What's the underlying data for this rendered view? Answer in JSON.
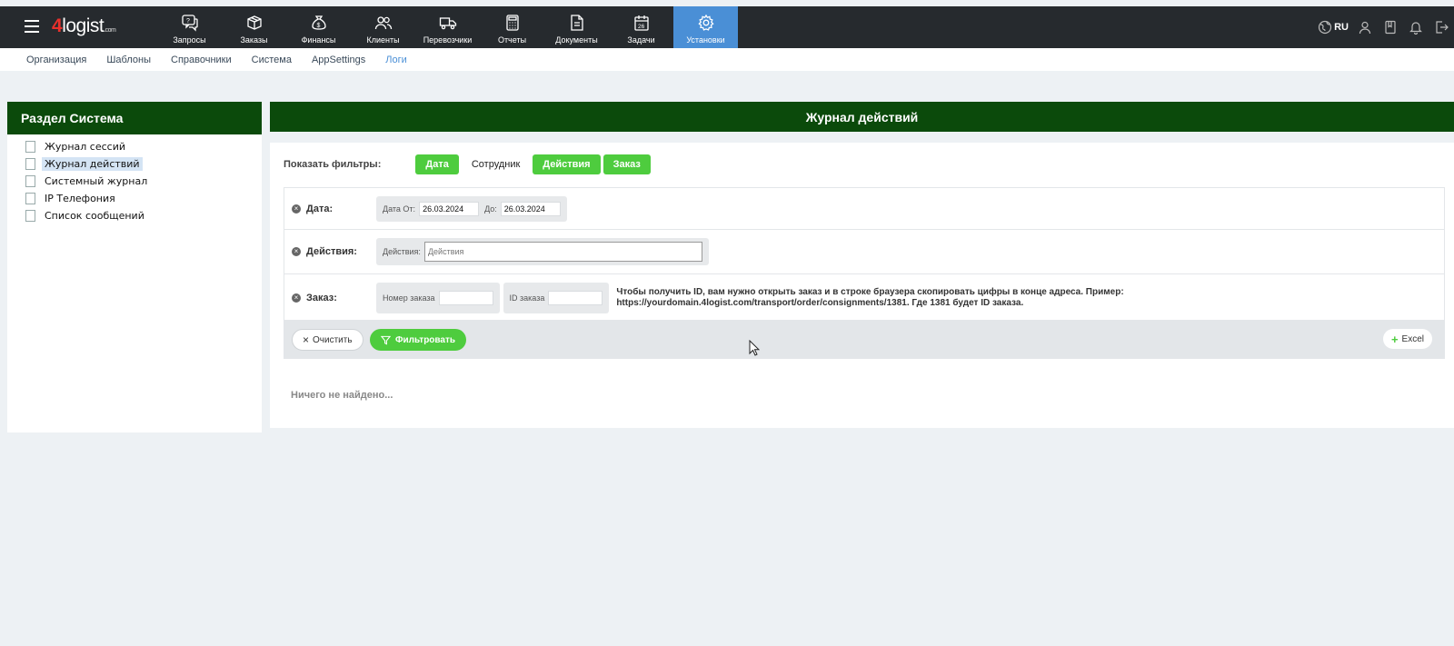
{
  "header": {
    "logo_num": "4",
    "logo_text": "logist",
    "logo_suffix": ".com",
    "nav": [
      {
        "label": "Запросы",
        "icon": "chat-question-icon"
      },
      {
        "label": "Заказы",
        "icon": "package-icon"
      },
      {
        "label": "Финансы",
        "icon": "money-bag-icon"
      },
      {
        "label": "Клиенты",
        "icon": "users-icon"
      },
      {
        "label": "Перевозчики",
        "icon": "truck-icon"
      },
      {
        "label": "Отчеты",
        "icon": "calculator-icon"
      },
      {
        "label": "Документы",
        "icon": "document-icon"
      },
      {
        "label": "Задачи",
        "icon": "calendar-icon"
      },
      {
        "label": "Установки",
        "icon": "gear-icon",
        "active": true
      }
    ],
    "lang": "RU"
  },
  "subnav": {
    "items": [
      "Организация",
      "Шаблоны",
      "Справочники",
      "Система",
      "AppSettings",
      "Логи"
    ],
    "active": "Логи"
  },
  "left_panel": {
    "title": "Раздел Система",
    "items": [
      "Журнал сессий",
      "Журнал действий",
      "Системный журнал",
      "IP Телефония",
      "Список сообщений"
    ],
    "selected": "Журнал действий"
  },
  "main": {
    "title": "Журнал действий",
    "show_filters_label": "Показать фильтры:",
    "chips": [
      {
        "label": "Дата",
        "on": true
      },
      {
        "label": "Сотрудник",
        "on": false
      },
      {
        "label": "Действия",
        "on": true
      },
      {
        "label": "Заказ",
        "on": true
      }
    ],
    "filters": {
      "date": {
        "label": "Дата:",
        "from_label": "Дата От:",
        "from_value": "26.03.2024",
        "to_label": "До:",
        "to_value": "26.03.2024"
      },
      "actions": {
        "label": "Действия:",
        "field_label": "Действия:",
        "placeholder": "Действия"
      },
      "order": {
        "label": "Заказ:",
        "number_label": "Номер заказа",
        "id_label": "ID заказа",
        "hint": "Чтобы получить ID, вам нужно открыть заказ и в строке браузера скопировать цифры в конце адреса. Пример: https://yourdomain.4logist.com/transport/order/consignments/1381. Где 1381 будет ID заказа."
      }
    },
    "buttons": {
      "clear": "Очистить",
      "filter": "Фильтровать",
      "excel": "Excel"
    },
    "empty_text": "Ничего не найдено..."
  },
  "colors": {
    "accent": "#4a8fd6",
    "header_green": "#0b4a0b",
    "chip_green": "#4ecc3e",
    "topbar": "#262a2e"
  }
}
